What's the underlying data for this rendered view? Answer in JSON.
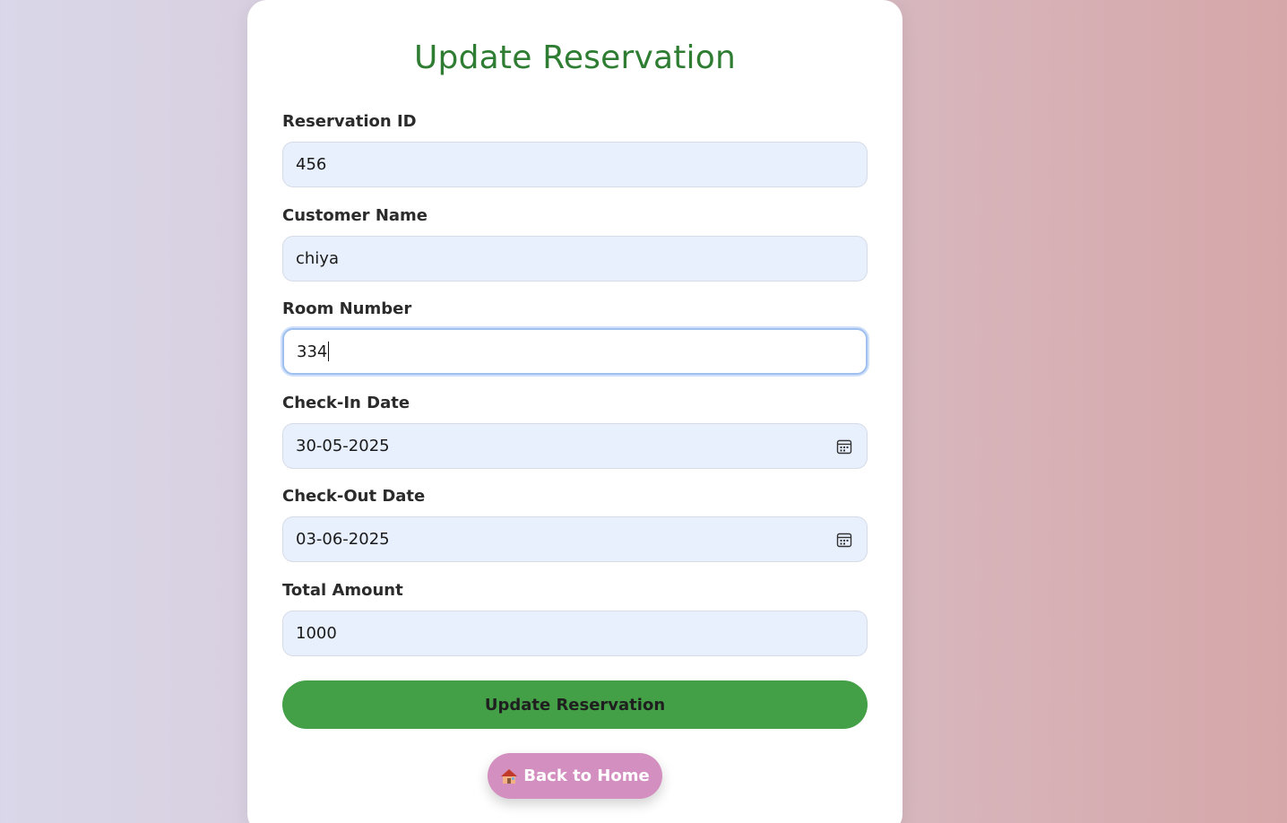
{
  "form": {
    "title": "Update Reservation",
    "fields": [
      {
        "label": "Reservation ID",
        "value": "456",
        "icon": ""
      },
      {
        "label": "Customer Name",
        "value": "chiya",
        "icon": ""
      },
      {
        "label": "Room Number",
        "value": "334",
        "icon": ""
      },
      {
        "label": "Check-In Date",
        "value": "30-05-2025",
        "icon": "calendar-icon"
      },
      {
        "label": "Check-Out Date",
        "value": "03-06-2025",
        "icon": "calendar-icon"
      },
      {
        "label": "Total Amount",
        "value": "1000",
        "icon": ""
      }
    ],
    "focused_field": "Room Number",
    "submit_label": "Update Reservation",
    "home_label": "Back to Home",
    "home_icon": "house-icon"
  },
  "colors": {
    "title": "#2e7d32",
    "submit_bg": "#43a047",
    "home_bg": "#d38fbf",
    "input_bg": "#e8f0fe"
  }
}
